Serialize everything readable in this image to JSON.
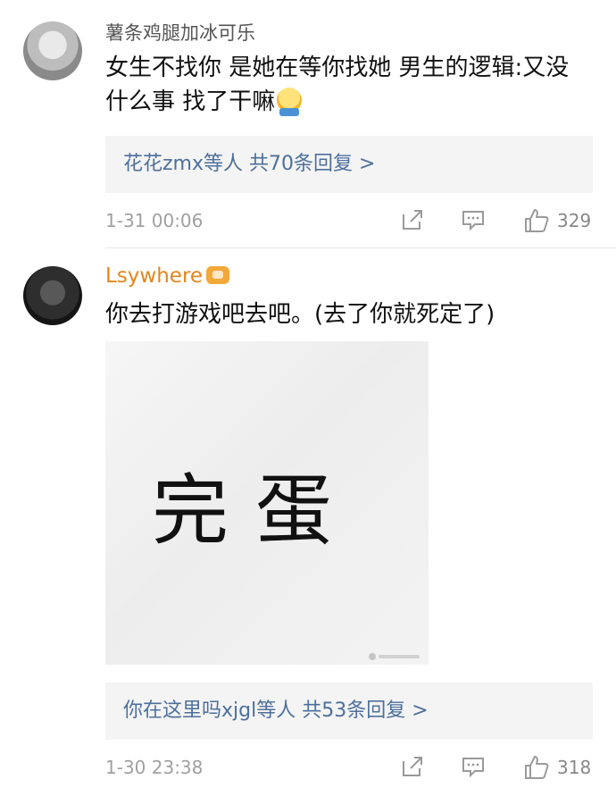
{
  "comments": [
    {
      "username": "薯条鸡腿加冰可乐",
      "text": "女生不找你 是她在等你找她  男生的逻辑:又没什么事 找了干嘛",
      "reply_summary": "花花zmx等人  共70条回复 >",
      "timestamp": "1-31 00:06",
      "like_count": "329"
    },
    {
      "username": "Lsywhere",
      "text": "你去打游戏吧去吧。(去了你就死定了)",
      "image_text": "完蛋",
      "reply_summary": "你在这里吗xjgl等人  共53条回复 >",
      "timestamp": "1-30 23:38",
      "like_count": "318"
    }
  ],
  "icons": {
    "share": "share-icon",
    "reply": "comment-icon",
    "like": "thumbs-up-icon",
    "emoji": "hug-emoji-icon",
    "vip": "vip-crown-icon"
  },
  "colors": {
    "username_vip": "#e3861b",
    "link": "#4d6f9c",
    "meta": "#a0a0a0"
  }
}
